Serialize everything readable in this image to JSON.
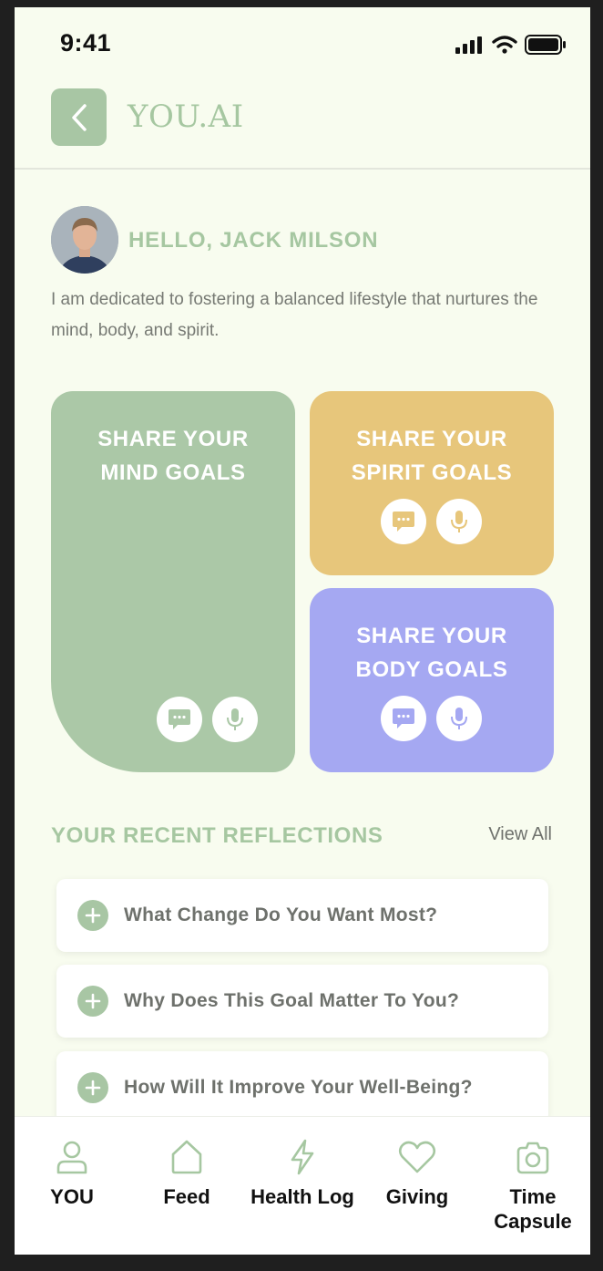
{
  "status_bar": {
    "time": "9:41"
  },
  "header": {
    "title": "YOU.AI"
  },
  "profile": {
    "greeting": "HELLO, JACK MILSON",
    "bio": "I am dedicated to fostering a balanced lifestyle that nurtures the mind, body, and spirit."
  },
  "cards": {
    "mind": {
      "line1": "SHARE YOUR",
      "line2": "MIND GOALS",
      "color": "#abc8a7"
    },
    "spirit": {
      "line1": "SHARE YOUR",
      "line2": "SPIRIT GOALS",
      "color": "#e7c67b"
    },
    "body": {
      "line1": "SHARE YOUR",
      "line2": "BODY GOALS",
      "color": "#a5a8f2"
    }
  },
  "reflections": {
    "title": "YOUR RECENT REFLECTIONS",
    "view_all": "View All",
    "items": [
      {
        "label": "What Change Do You Want Most?"
      },
      {
        "label": "Why Does This Goal Matter To You?"
      },
      {
        "label": "How Will It Improve Your Well-Being?"
      }
    ]
  },
  "nav": {
    "items": [
      {
        "label": "YOU",
        "icon": "user-icon"
      },
      {
        "label": "Feed",
        "icon": "home-icon"
      },
      {
        "label": "Health Log",
        "icon": "lightning-icon"
      },
      {
        "label": "Giving",
        "icon": "heart-icon"
      },
      {
        "label": "Time Capsule",
        "icon": "camera-icon"
      }
    ]
  },
  "colors": {
    "accent": "#a6c7a1",
    "background": "#f8fcef"
  }
}
